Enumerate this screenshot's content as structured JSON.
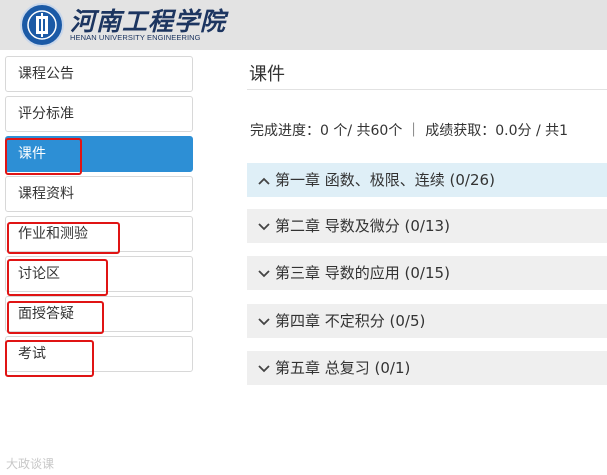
{
  "header": {
    "school_name": "河南工程学院",
    "school_name_en": "HENAN UNIVERSITY ENGINEERING",
    "logo_icon": "university-emblem",
    "accent_color": "#1b5aa6"
  },
  "sidebar": {
    "items": [
      {
        "label": "课程公告",
        "active": false,
        "highlighted": false
      },
      {
        "label": "评分标准",
        "active": false,
        "highlighted": false
      },
      {
        "label": "课件",
        "active": true,
        "highlighted": true
      },
      {
        "label": "课程资料",
        "active": false,
        "highlighted": false
      },
      {
        "label": "作业和测验",
        "active": false,
        "highlighted": true
      },
      {
        "label": "讨论区",
        "active": false,
        "highlighted": true
      },
      {
        "label": "面授答疑",
        "active": false,
        "highlighted": true
      },
      {
        "label": "考试",
        "active": false,
        "highlighted": true
      }
    ],
    "active_color": "#2d8fd5",
    "highlight_color": "#e01414"
  },
  "main": {
    "title": "课件",
    "progress_text": "完成进度：0 个/ 共60个 ｜ 成绩获取：0.0分 / 共1",
    "chapters": [
      {
        "label": "第一章 函数、极限、连续 (0/26)",
        "expanded": true,
        "chevron_icon": "chevron-up-icon"
      },
      {
        "label": "第二章 导数及微分 (0/13)",
        "expanded": false,
        "chevron_icon": "chevron-down-icon"
      },
      {
        "label": "第三章 导数的应用 (0/15)",
        "expanded": false,
        "chevron_icon": "chevron-down-icon"
      },
      {
        "label": "第四章 不定积分 (0/5)",
        "expanded": false,
        "chevron_icon": "chevron-down-icon"
      },
      {
        "label": "第五章 总复习 (0/1)",
        "expanded": false,
        "chevron_icon": "chevron-down-icon"
      }
    ]
  },
  "watermark": "大政谈课"
}
